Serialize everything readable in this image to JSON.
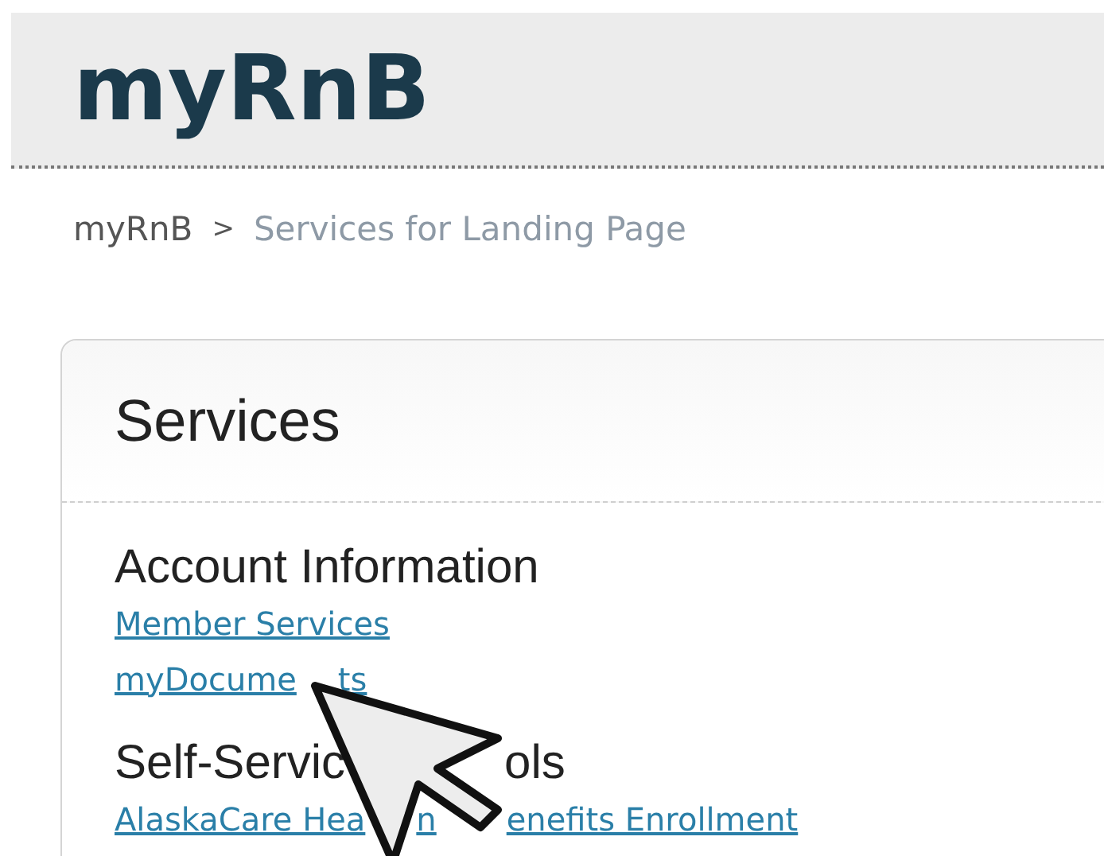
{
  "header": {
    "title": "myRnB"
  },
  "breadcrumb": {
    "items": [
      "myRnB",
      "Services for Landing Page"
    ],
    "separator": ">"
  },
  "panel": {
    "title": "Services",
    "sections": [
      {
        "heading": [
          "Account Information"
        ],
        "links": [
          [
            "Member Services"
          ],
          [
            "myDocume",
            "ts"
          ]
        ]
      },
      {
        "heading": [
          "Self-Servic",
          "ols"
        ],
        "links": [
          [
            "AlaskaCare Hea",
            "n",
            "enefits Enrollment"
          ]
        ]
      }
    ]
  }
}
